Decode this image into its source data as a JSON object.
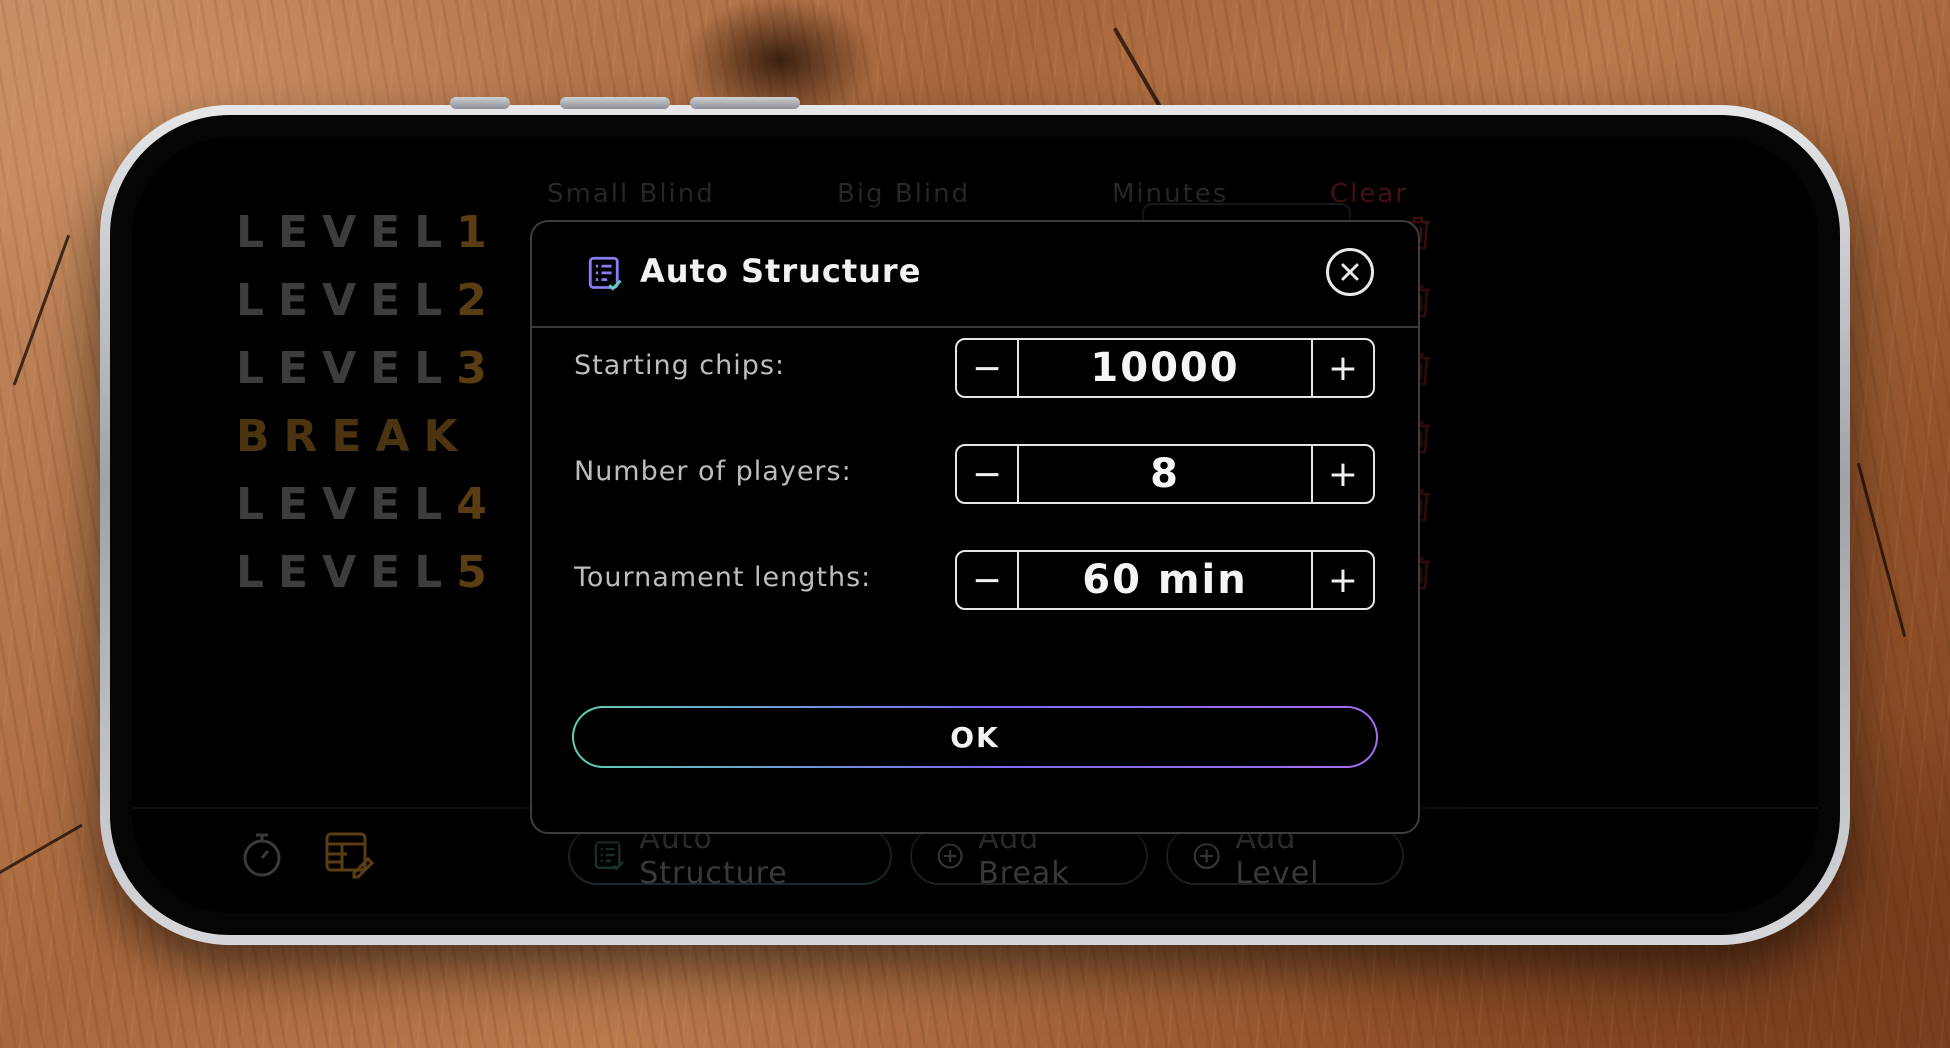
{
  "table": {
    "headers": {
      "small_blind": "Small Blind",
      "big_blind": "Big Blind",
      "minutes": "Minutes",
      "clear": "Clear"
    },
    "rows": [
      {
        "word": "LEVEL",
        "num": "1"
      },
      {
        "word": "LEVEL",
        "num": "2"
      },
      {
        "word": "LEVEL",
        "num": "3"
      },
      {
        "word": "BREAK",
        "num": ""
      },
      {
        "word": "LEVEL",
        "num": "4"
      },
      {
        "word": "LEVEL",
        "num": "5"
      }
    ]
  },
  "bottom": {
    "auto_structure": "Auto Structure",
    "add_break": "Add Break",
    "add_level": "Add Level"
  },
  "dialog": {
    "title": "Auto Structure",
    "fields": [
      {
        "label": "Starting chips:",
        "value": "10000"
      },
      {
        "label": "Number of players:",
        "value": "8"
      },
      {
        "label": "Tournament lengths:",
        "value": "60 min"
      }
    ],
    "ok_label": "OK"
  },
  "icons": {
    "minus": "−",
    "plus": "+"
  },
  "colors": {
    "accent_gold": "#5a3d12",
    "clear_red": "#4a1313",
    "ok_gradient_start": "#5fd0b3",
    "ok_gradient_end": "#a36df2"
  }
}
